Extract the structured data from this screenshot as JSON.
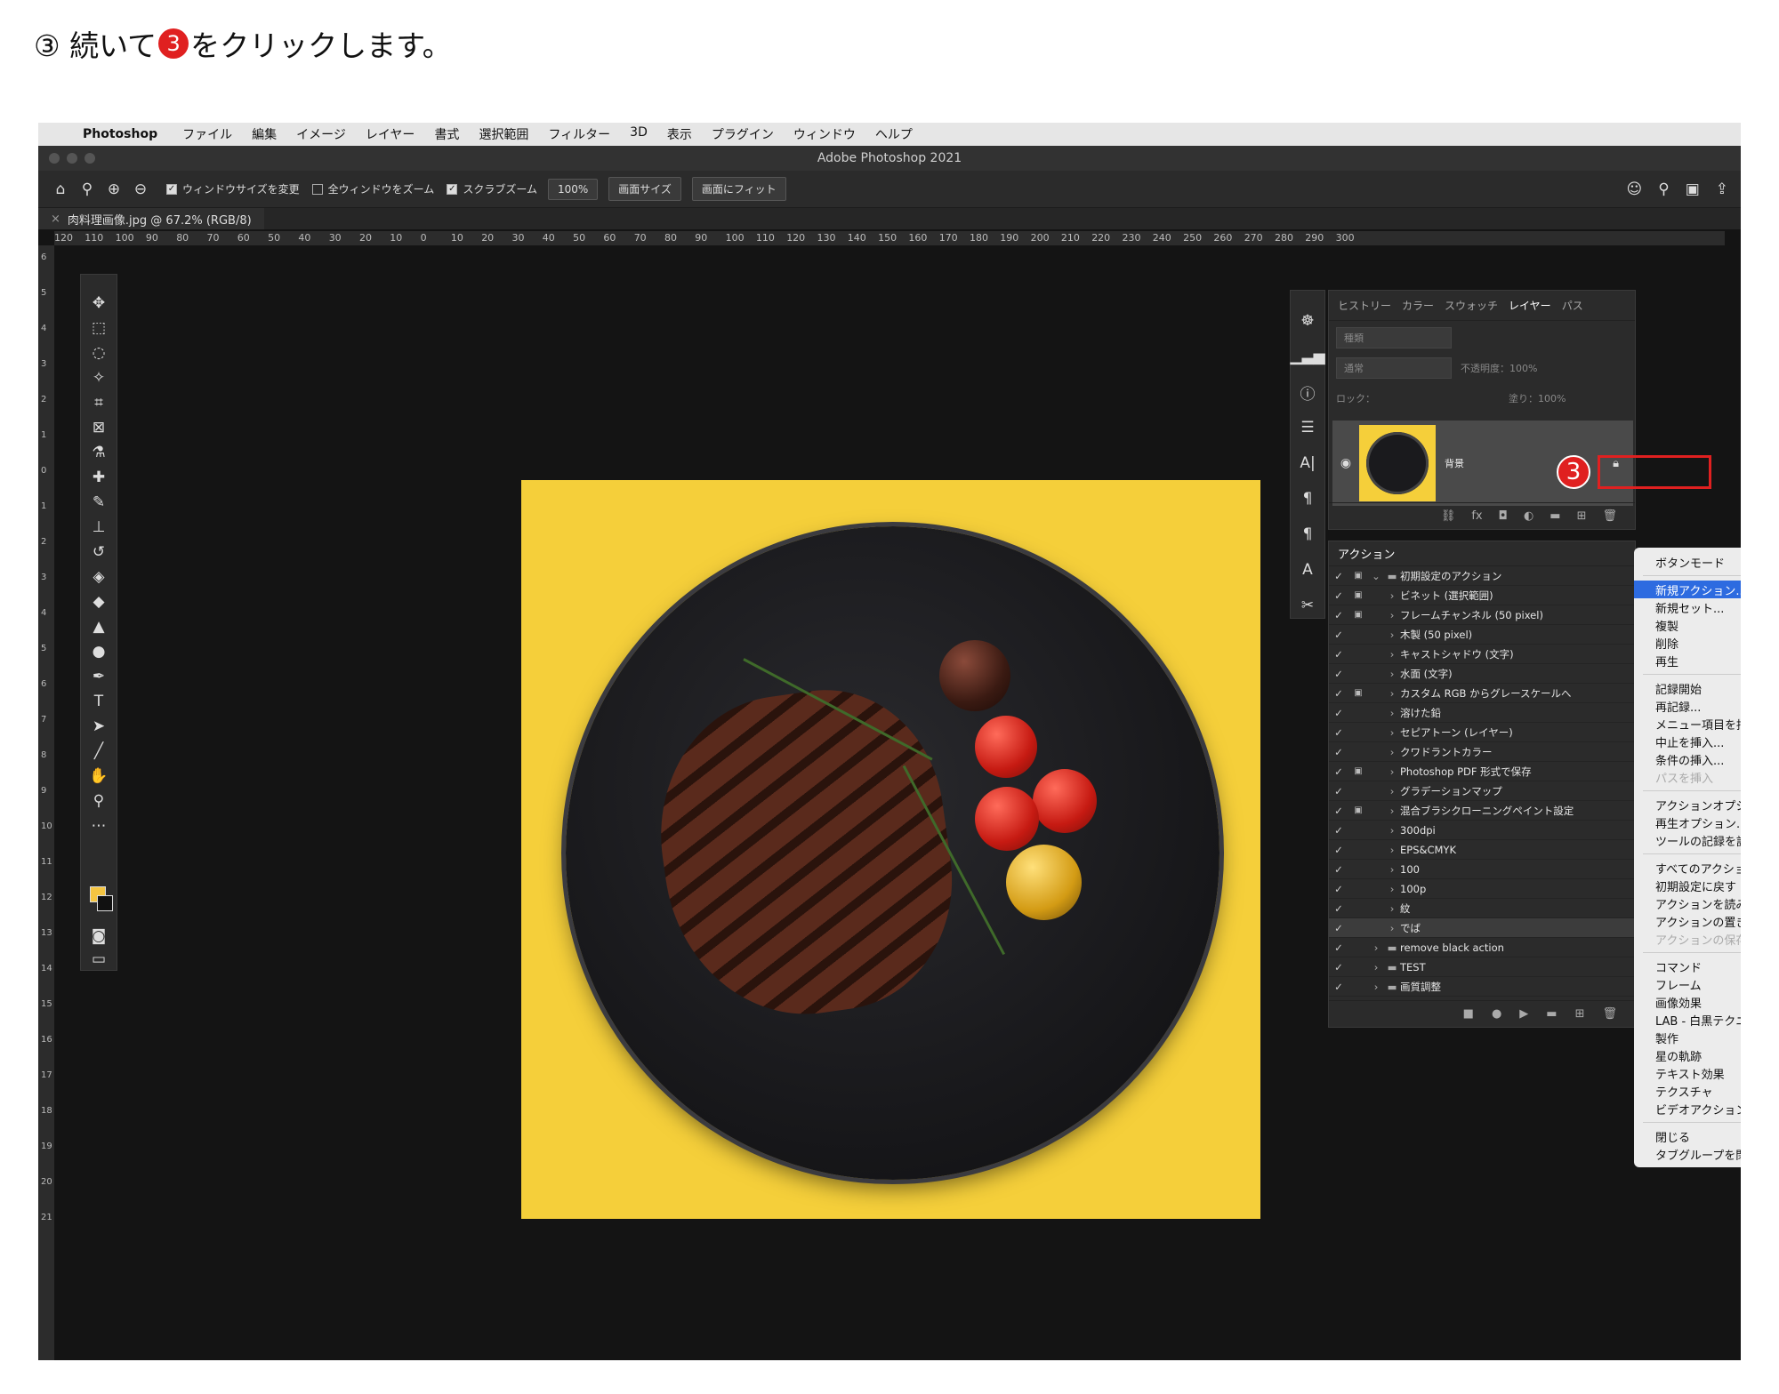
{
  "instruction": {
    "prefix": "③ 続いて",
    "num": "3",
    "suffix": "をクリックします。"
  },
  "menubar": {
    "app": "Photoshop",
    "items": [
      "ファイル",
      "編集",
      "イメージ",
      "レイヤー",
      "書式",
      "選択範囲",
      "フィルター",
      "3D",
      "表示",
      "プラグイン",
      "ウィンドウ",
      "ヘルプ"
    ]
  },
  "window": {
    "title": "Adobe Photoshop 2021"
  },
  "options": {
    "resize": "ウィンドウサイズを変更",
    "zoom_all": "全ウィンドウをズーム",
    "scrubby": "スクラブズーム",
    "zoom": "100%",
    "fit_screen": "画面サイズ",
    "fill_screen": "画面にフィット"
  },
  "doc_tab": {
    "label": "肉料理画像.jpg @ 67.2% (RGB/8)"
  },
  "ruler_h": [
    "120",
    "110",
    "100",
    "90",
    "80",
    "70",
    "60",
    "50",
    "40",
    "30",
    "20",
    "10",
    "0",
    "10",
    "20",
    "30",
    "40",
    "50",
    "60",
    "70",
    "80",
    "90",
    "100",
    "110",
    "120",
    "130",
    "140",
    "150",
    "160",
    "170",
    "180",
    "190",
    "200",
    "210",
    "220",
    "230",
    "240",
    "250",
    "260",
    "270",
    "280",
    "290",
    "300"
  ],
  "ruler_v": [
    "6",
    "5",
    "4",
    "3",
    "2",
    "1",
    "0",
    "1",
    "2",
    "3",
    "4",
    "5",
    "6",
    "7",
    "8",
    "9",
    "10",
    "11",
    "12",
    "13",
    "14",
    "15",
    "16",
    "17",
    "18",
    "19",
    "20",
    "21"
  ],
  "layers_panel": {
    "tabs": [
      "ヒストリー",
      "カラー",
      "スウォッチ",
      "レイヤー",
      "パス"
    ],
    "filter": "種類",
    "blend": "通常",
    "opacity_label": "不透明度：",
    "opacity": "100%",
    "lock_label": "ロック：",
    "fill_label": "塗り：",
    "fill": "100%",
    "layer_name": "背景"
  },
  "actions_panel": {
    "title": "アクション",
    "rows": [
      {
        "label": "初期設定のアクション",
        "set": true,
        "open": true,
        "box": true
      },
      {
        "label": "ビネット (選択範囲)",
        "box": true
      },
      {
        "label": "フレームチャンネル (50 pixel)",
        "box": true
      },
      {
        "label": "木製 (50 pixel)"
      },
      {
        "label": "キャストシャドウ (文字)"
      },
      {
        "label": "水面 (文字)"
      },
      {
        "label": "カスタム RGB からグレースケールへ",
        "box": true
      },
      {
        "label": "溶けた鉛"
      },
      {
        "label": "セピアトーン (レイヤー)"
      },
      {
        "label": "クワドラントカラー"
      },
      {
        "label": "Photoshop PDF 形式で保存",
        "box": true
      },
      {
        "label": "グラデーションマップ"
      },
      {
        "label": "混合ブラシクローニングペイント設定",
        "box": true
      },
      {
        "label": "300dpi"
      },
      {
        "label": "EPS&CMYK"
      },
      {
        "label": "100"
      },
      {
        "label": "100p"
      },
      {
        "label": "紋"
      },
      {
        "label": "でば",
        "sel": true
      },
      {
        "label": "remove black action",
        "set": true
      },
      {
        "label": "TEST",
        "set": true
      },
      {
        "label": "画質調整",
        "set": true
      }
    ]
  },
  "context_menu": {
    "groups": [
      [
        {
          "label": "ボタンモード"
        }
      ],
      [
        {
          "label": "新規アクション...",
          "hi": true
        },
        {
          "label": "新規セット..."
        },
        {
          "label": "複製"
        },
        {
          "label": "削除"
        },
        {
          "label": "再生"
        }
      ],
      [
        {
          "label": "記録開始"
        },
        {
          "label": "再記録..."
        },
        {
          "label": "メニュー項目を挿"
        },
        {
          "label": "中止を挿入..."
        },
        {
          "label": "条件の挿入..."
        },
        {
          "label": "パスを挿入",
          "dis": true
        }
      ],
      [
        {
          "label": "アクションオプシ"
        },
        {
          "label": "再生オプション..."
        },
        {
          "label": "ツールの記録を許"
        }
      ],
      [
        {
          "label": "すべてのアクショ"
        },
        {
          "label": "初期設定に戻す"
        },
        {
          "label": "アクションを読み"
        },
        {
          "label": "アクションの置き"
        },
        {
          "label": "アクションの保存",
          "dis": true
        }
      ],
      [
        {
          "label": "コマンド"
        },
        {
          "label": "フレーム"
        },
        {
          "label": "画像効果"
        },
        {
          "label": "LAB - 白黒テクニ"
        },
        {
          "label": "製作"
        },
        {
          "label": "星の軌跡"
        },
        {
          "label": "テキスト効果"
        },
        {
          "label": "テクスチャ"
        },
        {
          "label": "ビデオアクション"
        }
      ],
      [
        {
          "label": "閉じる"
        },
        {
          "label": "タブグループを閉"
        }
      ]
    ]
  },
  "callout": "3"
}
